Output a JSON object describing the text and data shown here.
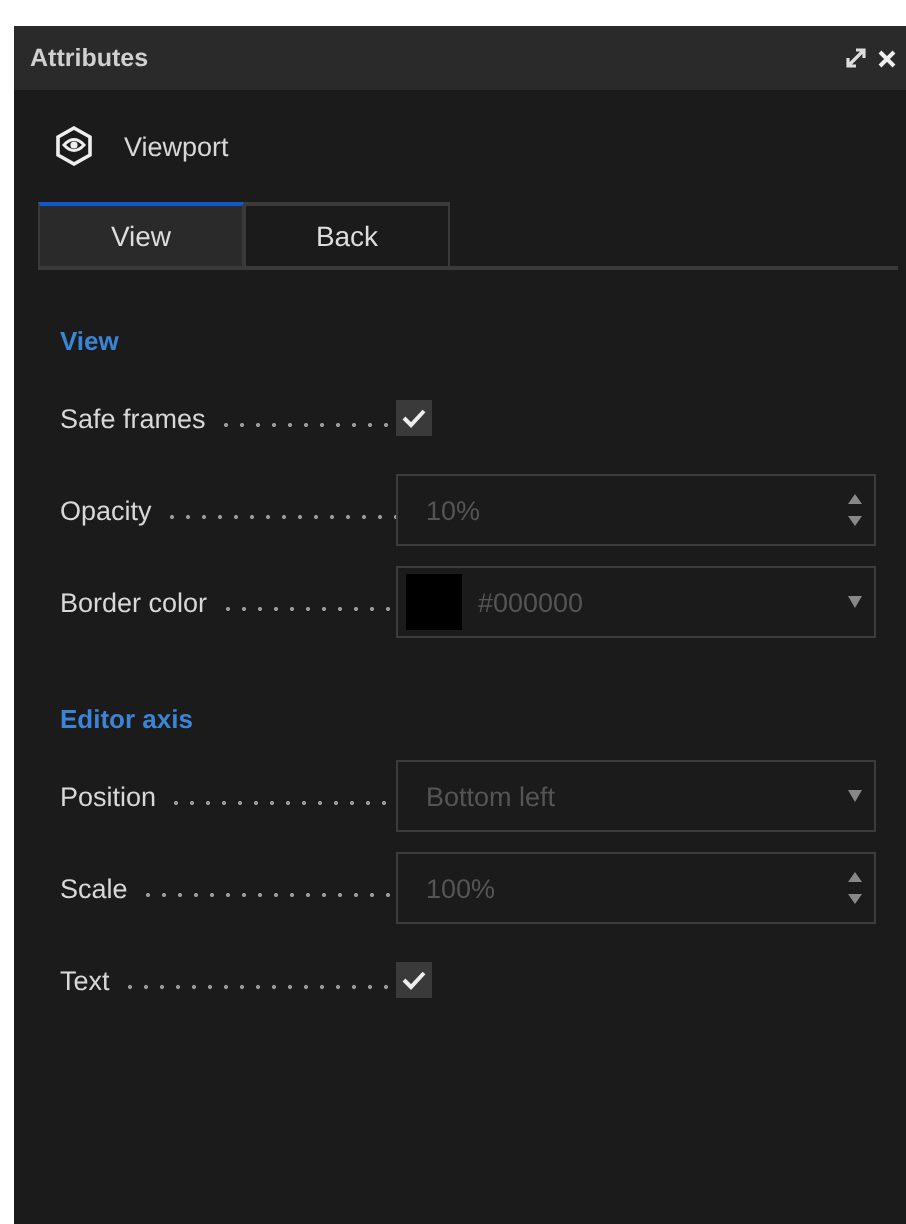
{
  "panel": {
    "title": "Attributes"
  },
  "header": {
    "title": "Viewport"
  },
  "tabs": [
    {
      "label": "View",
      "selected": true
    },
    {
      "label": "Back",
      "selected": false
    }
  ],
  "sections": [
    {
      "title": "View",
      "rows": [
        {
          "kind": "checkbox",
          "label": "Safe frames",
          "checked": true
        },
        {
          "kind": "spinner",
          "label": "Opacity",
          "value": "10%"
        },
        {
          "kind": "color",
          "label": "Border color",
          "color": "#000000",
          "value": "#000000"
        }
      ]
    },
    {
      "title": "Editor axis",
      "rows": [
        {
          "kind": "dropdown",
          "label": "Position",
          "value": "Bottom left"
        },
        {
          "kind": "spinner",
          "label": "Scale",
          "value": "100%"
        },
        {
          "kind": "checkbox",
          "label": "Text",
          "checked": true
        }
      ]
    }
  ]
}
